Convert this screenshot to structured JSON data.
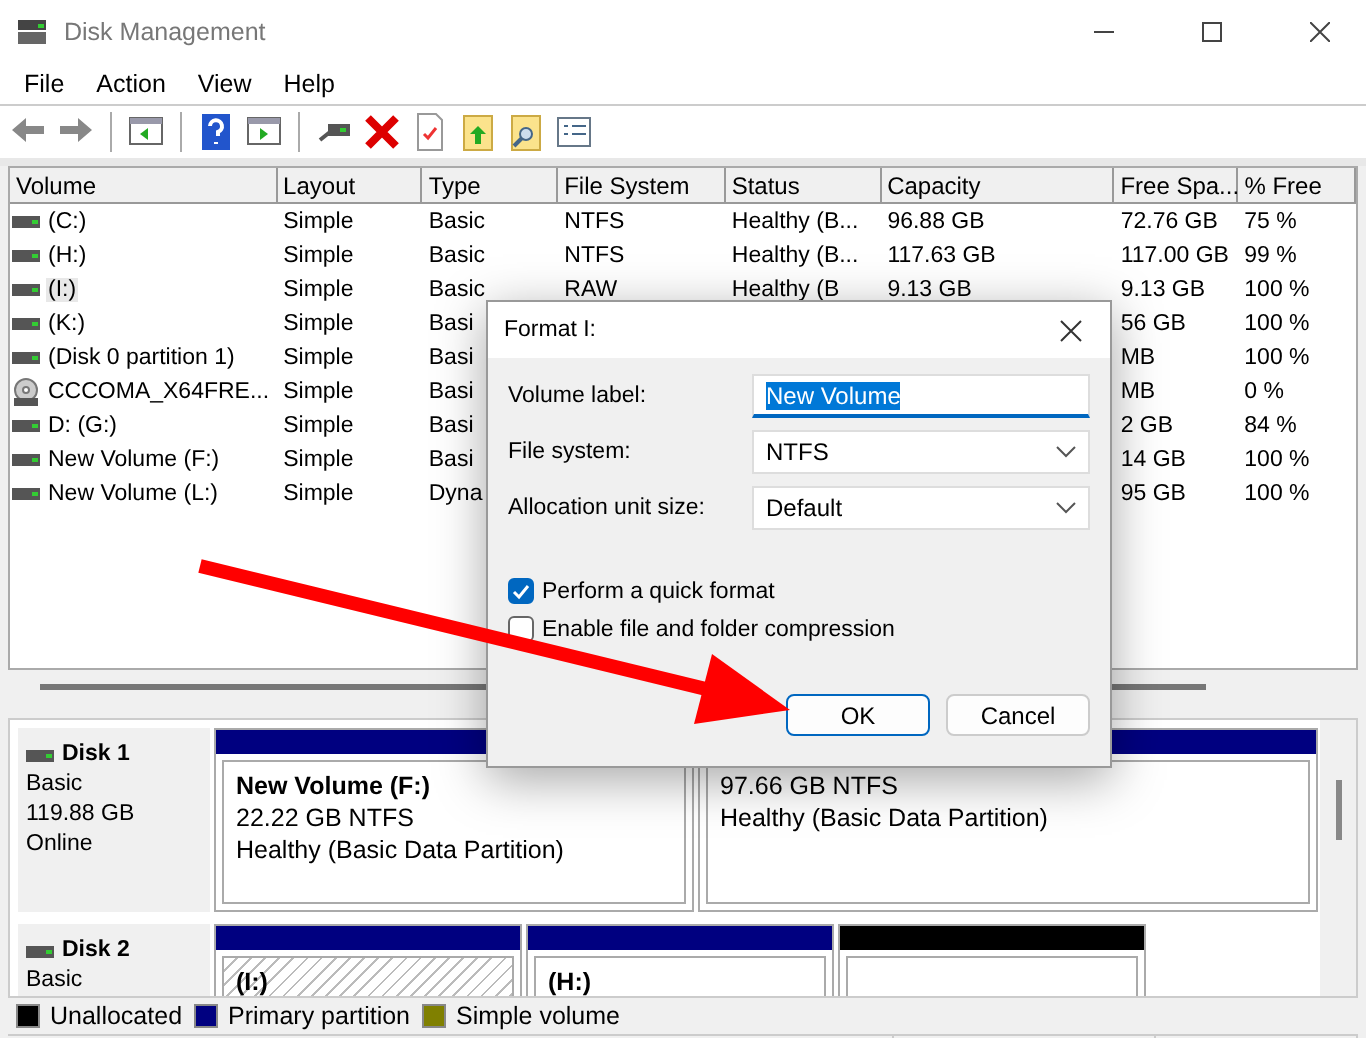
{
  "window": {
    "title": "Disk Management"
  },
  "menu": [
    "File",
    "Action",
    "View",
    "Help"
  ],
  "table": {
    "columns": [
      "Volume",
      "Layout",
      "Type",
      "File System",
      "Status",
      "Capacity",
      "Free Spa...",
      "% Free"
    ],
    "rows": [
      {
        "kind": "drive",
        "selected": false,
        "volume": "(C:)",
        "layout": "Simple",
        "type": "Basic",
        "file_system": "NTFS",
        "status": "Healthy (B...",
        "capacity": "96.88 GB",
        "free_space": "72.76 GB",
        "percent_free": "75 %"
      },
      {
        "kind": "drive",
        "selected": false,
        "volume": "(H:)",
        "layout": "Simple",
        "type": "Basic",
        "file_system": "NTFS",
        "status": "Healthy (B...",
        "capacity": "117.63 GB",
        "free_space": "117.00 GB",
        "percent_free": "99 %"
      },
      {
        "kind": "drive",
        "selected": true,
        "volume": "(I:)",
        "layout": "Simple",
        "type": "Basic",
        "file_system": "RAW",
        "status": "Healthy (B",
        "capacity": "9.13 GB",
        "free_space": "9.13 GB",
        "percent_free": "100 %"
      },
      {
        "kind": "drive",
        "selected": false,
        "volume": "(K:)",
        "layout": "Simple",
        "type": "Basi",
        "free_space": "56 GB",
        "percent_free": "100 %"
      },
      {
        "kind": "drive",
        "selected": false,
        "volume": "(Disk 0 partition 1)",
        "layout": "Simple",
        "type": "Basi",
        "free_space": "MB",
        "percent_free": "100 %"
      },
      {
        "kind": "disc",
        "selected": false,
        "volume": "CCCOMA_X64FRE...",
        "layout": "Simple",
        "type": "Basi",
        "free_space": "MB",
        "percent_free": "0 %"
      },
      {
        "kind": "drive",
        "selected": false,
        "volume": "D: (G:)",
        "layout": "Simple",
        "type": "Basi",
        "free_space": "2 GB",
        "percent_free": "84 %"
      },
      {
        "kind": "drive",
        "selected": false,
        "volume": "New Volume (F:)",
        "layout": "Simple",
        "type": "Basi",
        "free_space": "14 GB",
        "percent_free": "100 %"
      },
      {
        "kind": "drive",
        "selected": false,
        "volume": "New Volume (L:)",
        "layout": "Simple",
        "type": "Dyna",
        "free_space": "95 GB",
        "percent_free": "100 %"
      }
    ]
  },
  "disks": [
    {
      "name": "Disk 1",
      "type": "Basic",
      "size": "119.88 GB",
      "status": "Online",
      "partitions": [
        {
          "kind": "primary",
          "selected": false,
          "title": "New Volume  (F:)",
          "size_fs": "22.22 GB NTFS",
          "status": "Healthy (Basic Data Partition)"
        },
        {
          "kind": "primary",
          "selected": false,
          "size_fs": "97.66 GB NTFS",
          "status": "Healthy (Basic Data Partition)"
        }
      ]
    },
    {
      "name": "Disk 2",
      "type": "Basic",
      "partitions": [
        {
          "kind": "primary",
          "selected": true,
          "title": "(I:)"
        },
        {
          "kind": "primary",
          "selected": false,
          "title": "(H:)"
        },
        {
          "kind": "unallocated",
          "selected": false
        }
      ]
    }
  ],
  "legend": [
    {
      "label": "Unallocated",
      "color": "#000000"
    },
    {
      "label": "Primary partition",
      "color": "#000080"
    },
    {
      "label": "Simple volume",
      "color": "#808000"
    }
  ],
  "dialog": {
    "title": "Format I:",
    "fields": [
      {
        "kind": "text",
        "label": "Volume label:",
        "value": "New Volume"
      },
      {
        "kind": "select",
        "label": "File system:",
        "value": "NTFS"
      },
      {
        "kind": "select",
        "label": "Allocation unit size:",
        "value": "Default"
      }
    ],
    "options": [
      {
        "label": "Perform a quick format",
        "checked": true
      },
      {
        "label": "Enable file and folder compression",
        "checked": false
      }
    ],
    "buttons": [
      {
        "label": "OK",
        "default": true
      },
      {
        "label": "Cancel",
        "default": false
      }
    ]
  }
}
